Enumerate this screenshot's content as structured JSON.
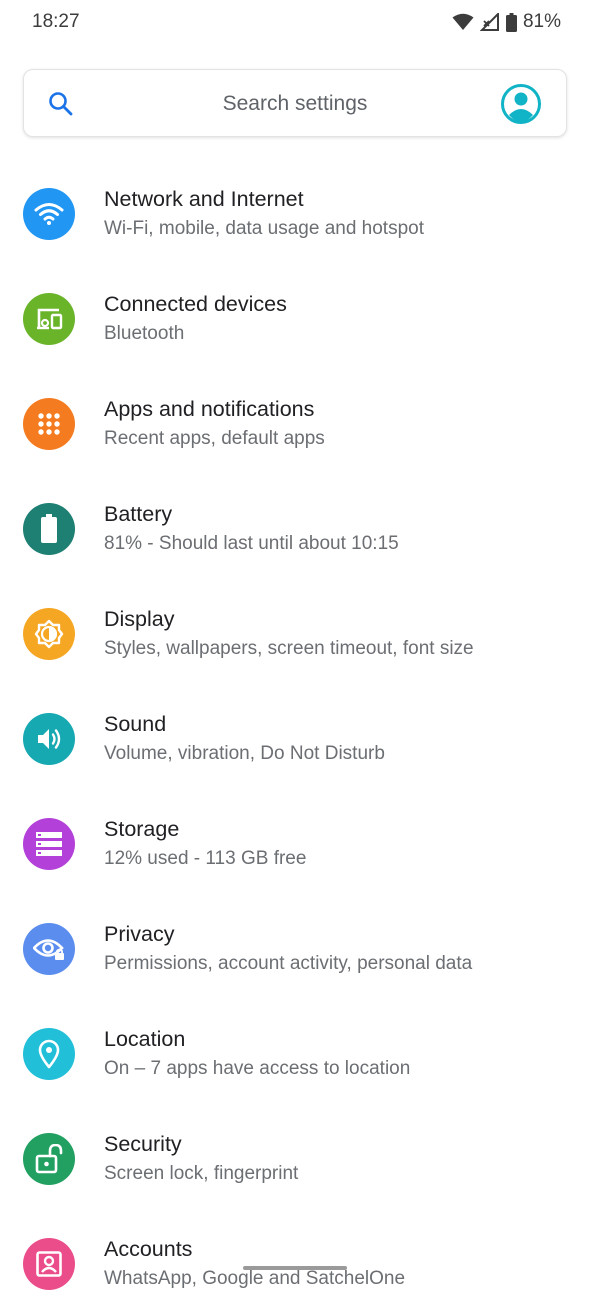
{
  "status_bar": {
    "time": "18:27",
    "battery_percent": "81%"
  },
  "search": {
    "placeholder": "Search settings"
  },
  "colors": {
    "network": "#2196f3",
    "connected": "#6ab42a",
    "apps": "#f47b20",
    "battery": "#1e7f73",
    "display": "#f5a623",
    "sound": "#16a9b1",
    "storage": "#b341d9",
    "privacy": "#5b8def",
    "location": "#22bfd8",
    "security": "#22a061",
    "accounts": "#ea4d8a",
    "accent": "#11b3c6"
  },
  "settings": [
    {
      "icon": "wifi-icon",
      "title": "Network and Internet",
      "subtitle": "Wi-Fi, mobile, data usage and hotspot"
    },
    {
      "icon": "devices-icon",
      "title": "Connected devices",
      "subtitle": "Bluetooth"
    },
    {
      "icon": "apps-grid-icon",
      "title": "Apps and notifications",
      "subtitle": "Recent apps, default apps"
    },
    {
      "icon": "battery-icon",
      "title": "Battery",
      "subtitle": "81% - Should last until about 10:15"
    },
    {
      "icon": "brightness-icon",
      "title": "Display",
      "subtitle": "Styles, wallpapers, screen timeout, font size"
    },
    {
      "icon": "volume-icon",
      "title": "Sound",
      "subtitle": "Volume, vibration, Do Not Disturb"
    },
    {
      "icon": "storage-icon",
      "title": "Storage",
      "subtitle": "12% used - 113 GB free"
    },
    {
      "icon": "privacy-eye-icon",
      "title": "Privacy",
      "subtitle": "Permissions, account activity, personal data"
    },
    {
      "icon": "location-pin-icon",
      "title": "Location",
      "subtitle": "On – 7 apps have access to location"
    },
    {
      "icon": "lock-open-icon",
      "title": "Security",
      "subtitle": "Screen lock, fingerprint"
    },
    {
      "icon": "account-box-icon",
      "title": "Accounts",
      "subtitle": "WhatsApp, Google and SatchelOne"
    }
  ]
}
